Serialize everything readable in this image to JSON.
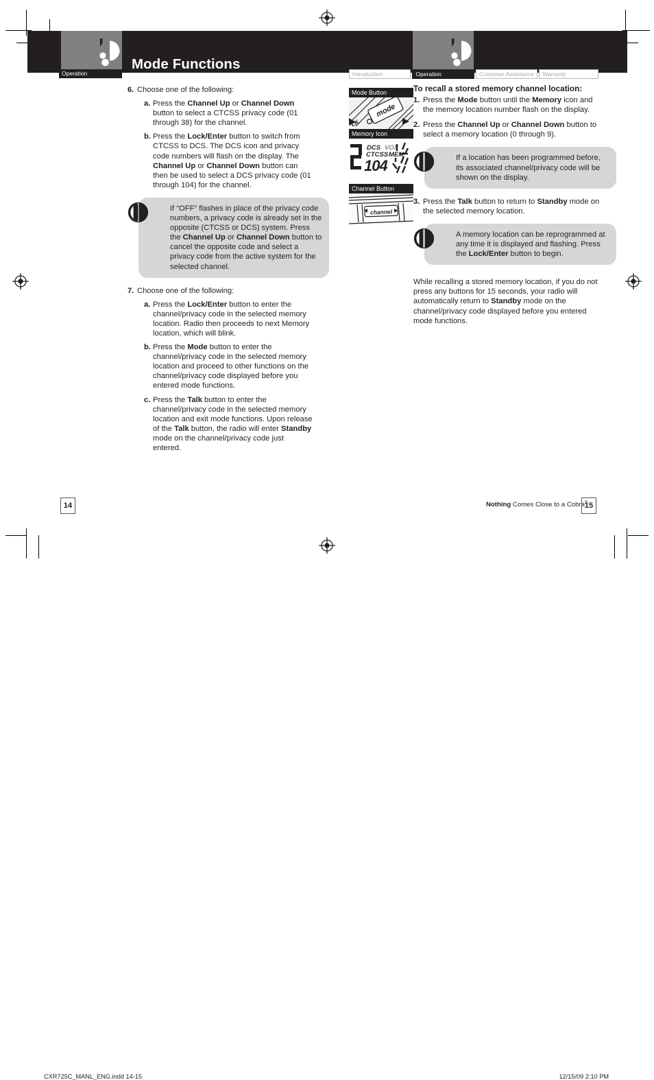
{
  "document": {
    "title": "Mode Functions",
    "left_section_tab": "Operation"
  },
  "nav_tabs": [
    {
      "label": "Introduction",
      "active": false
    },
    {
      "label": "Operation",
      "active": true
    },
    {
      "label": "Customer Assistance",
      "active": false
    },
    {
      "label": "Warranty",
      "active": false
    }
  ],
  "left_column": {
    "step6": {
      "marker": "6.",
      "text": "Choose one of the following:",
      "sub": [
        {
          "marker": "a.",
          "parts": [
            {
              "t": "Press the ",
              "b": false
            },
            {
              "t": "Channel Up",
              "b": true
            },
            {
              "t": " or ",
              "b": false
            },
            {
              "t": "Channel Down",
              "b": true
            },
            {
              "t": " button to select a CTCSS privacy code (01 through 38) for the channel.",
              "b": false
            }
          ]
        },
        {
          "marker": "b.",
          "parts": [
            {
              "t": "Press the ",
              "b": false
            },
            {
              "t": "Lock/Enter",
              "b": true
            },
            {
              "t": " button to switch from CTCSS to DCS. The DCS icon and privacy code numbers will flash on the display. The ",
              "b": false
            },
            {
              "t": "Channel Up",
              "b": true
            },
            {
              "t": " or ",
              "b": false
            },
            {
              "t": "Channel Down",
              "b": true
            },
            {
              "t": " button can then be used to select a DCS privacy code (01 through 104) for the channel.",
              "b": false
            }
          ]
        }
      ]
    },
    "note1": {
      "icon": "note-bulb-icon",
      "parts": [
        {
          "t": "If “OFF” flashes in place of the privacy code numbers, a privacy code is already set in the opposite (CTCSS or DCS) system. Press the ",
          "b": false
        },
        {
          "t": "Channel Up",
          "b": true
        },
        {
          "t": " or ",
          "b": false
        },
        {
          "t": "Channel Down",
          "b": true
        },
        {
          "t": " button to cancel the opposite code and select a privacy code from the active system for the selected channel.",
          "b": false
        }
      ]
    },
    "step7": {
      "marker": "7.",
      "text": "Choose one of the following:",
      "sub": [
        {
          "marker": "a.",
          "parts": [
            {
              "t": "Press the ",
              "b": false
            },
            {
              "t": "Lock/Enter",
              "b": true
            },
            {
              "t": " button to enter the channel/privacy code in the selected memory location. Radio then proceeds to next Memory location, which will blink.",
              "b": false
            }
          ]
        },
        {
          "marker": "b.",
          "parts": [
            {
              "t": "Press the ",
              "b": false
            },
            {
              "t": "Mode",
              "b": true
            },
            {
              "t": " button to enter the channel/privacy code in the selected memory location and proceed to other functions on the channel/privacy code displayed before you entered mode functions.",
              "b": false
            }
          ]
        },
        {
          "marker": "c.",
          "parts": [
            {
              "t": "Press the ",
              "b": false
            },
            {
              "t": "Talk",
              "b": true
            },
            {
              "t": " button to enter the channel/privacy code in the selected memory location and exit mode functions. Upon release of the ",
              "b": false
            },
            {
              "t": "Talk",
              "b": true
            },
            {
              "t": " button, the radio will enter ",
              "b": false
            },
            {
              "t": "Standby",
              "b": true
            },
            {
              "t": " mode on the channel/privacy code just entered.",
              "b": false
            }
          ]
        }
      ]
    }
  },
  "figures": [
    {
      "caption": "Mode Button",
      "icon": "radio-keypad-photo",
      "label_on_key": "mode"
    },
    {
      "caption": "Memory Icon",
      "icon": "lcd-display-photo",
      "lcd": {
        "value": "104",
        "indicators": [
          "DCS",
          "VOX",
          "CTCSS",
          "MEM"
        ]
      }
    },
    {
      "caption": "Channel Button",
      "icon": "channel-rocker-photo",
      "label_on_key": "channel"
    }
  ],
  "right_column": {
    "heading": "To recall a stored memory channel location:",
    "steps": [
      {
        "marker": "1.",
        "parts": [
          {
            "t": "Press the ",
            "b": false
          },
          {
            "t": "Mode",
            "b": true
          },
          {
            "t": " button until the ",
            "b": false
          },
          {
            "t": "Memory",
            "b": true
          },
          {
            "t": " icon and the memory location number flash on the display.",
            "b": false
          }
        ]
      },
      {
        "marker": "2.",
        "parts": [
          {
            "t": "Press the ",
            "b": false
          },
          {
            "t": "Channel Up",
            "b": true
          },
          {
            "t": " or ",
            "b": false
          },
          {
            "t": "Channel Down",
            "b": true
          },
          {
            "t": " button to select a memory location (0 through 9).",
            "b": false
          }
        ]
      }
    ],
    "note1": {
      "icon": "note-bulb-icon",
      "parts": [
        {
          "t": "If a location has been programmed before, its associated channel/privacy code will be shown on the display.",
          "b": false
        }
      ]
    },
    "step3": {
      "marker": "3.",
      "parts": [
        {
          "t": "Press the ",
          "b": false
        },
        {
          "t": "Talk",
          "b": true
        },
        {
          "t": " button to return to ",
          "b": false
        },
        {
          "t": "Standby",
          "b": true
        },
        {
          "t": " mode on the selected memory location.",
          "b": false
        }
      ]
    },
    "note2": {
      "icon": "note-bulb-icon",
      "parts": [
        {
          "t": "A memory location can be reprogrammed at any time it is displayed and flashing. Press the ",
          "b": false
        },
        {
          "t": "Lock/Enter",
          "b": true
        },
        {
          "t": " button to begin.",
          "b": false
        }
      ]
    },
    "closing": {
      "parts": [
        {
          "t": "While recalling a stored memory location, if you do not press any buttons for 15 seconds, your radio will automatically return to ",
          "b": false
        },
        {
          "t": "Standby",
          "b": true
        },
        {
          "t": " mode on the channel/privacy code displayed before you entered mode functions.",
          "b": false
        }
      ]
    }
  },
  "footer": {
    "page_left": "14",
    "page_right": "15",
    "tagline_bold": "Nothing",
    "tagline_rest": " Comes Close to a Cobra",
    "tagline_mark": "®"
  },
  "slug": {
    "file": "CXR725C_MANL_ENG.indd   14-15",
    "timestamp": "12/15/09   2:10 PM"
  },
  "colors": {
    "header_black": "#231f20",
    "gray_panel": "#808083",
    "note_gray": "#d5d6d8",
    "tab_inactive_text": "#a8a8aa",
    "tab_border": "#b6b6b8"
  }
}
